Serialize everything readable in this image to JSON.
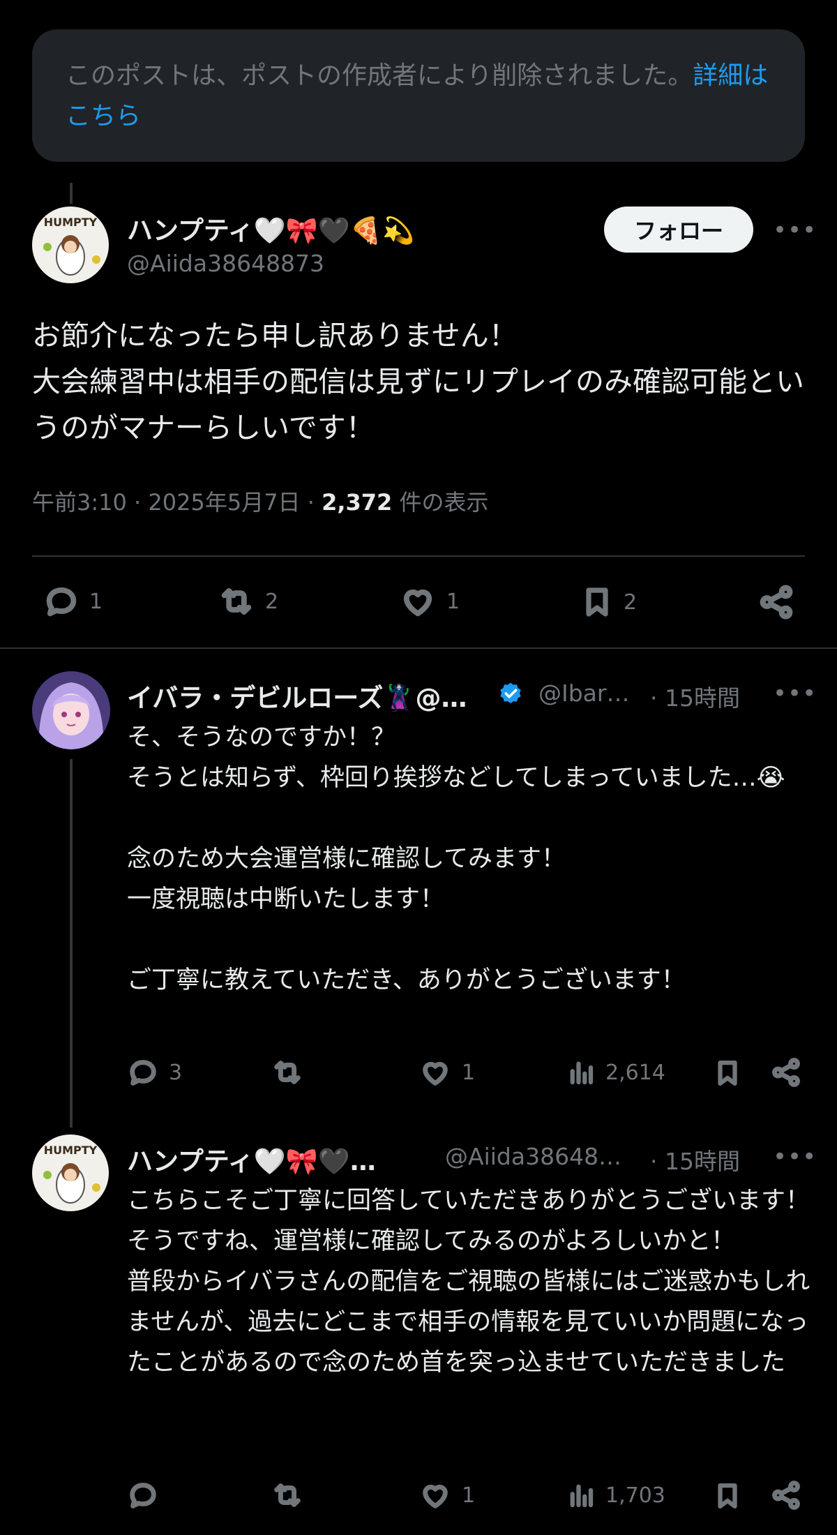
{
  "deleted_notice": {
    "text": "このポストは、ポストの作成者により削除されました。",
    "link": "詳細はこちら"
  },
  "main_post": {
    "display_name": "ハンプティ🤍🎀🖤🍕💫",
    "handle": "@Aiida38648873",
    "follow_label": "フォロー",
    "text": "お節介になったら申し訳ありません！\n大会練習中は相手の配信は見ずにリプレイのみ確認可能というのがマナーらしいです！",
    "time": "午前3:10",
    "date": "2025年5月7日",
    "views_count": "2,372",
    "views_label": "件の表示",
    "replies": "1",
    "reposts": "2",
    "likes": "1",
    "bookmarks": "2"
  },
  "reply1": {
    "display_name": "イバラ・デビルローズ🦹‍♂️@…",
    "handle": "@Ibar…",
    "time": "15時間",
    "text": "そ、そうなのですか！？\nそうとは知らず、枠回り挨拶などしてしまっていました…😭\n\n念のため大会運営様に確認してみます！\n一度視聴は中断いたします！\n\nご丁寧に教えていただき、ありがとうございます！",
    "replies": "3",
    "reposts": "",
    "likes": "1",
    "views": "2,614"
  },
  "reply2": {
    "display_name": "ハンプティ🤍🎀🖤…",
    "handle": "@Aiida38648…",
    "time": "15時間",
    "text": "こちらこそご丁寧に回答していただきありがとうございます！\nそうですね、運営様に確認してみるのがよろしいかと！\n普段からイバラさんの配信をご視聴の皆様にはご迷惑かもしれませんが、過去にどこまで相手の情報を見ていいか問題になったことがあるので念のため首を突っ込ませていただきました",
    "replies": "",
    "reposts": "",
    "likes": "1",
    "views": "1,703"
  },
  "avatar_text": "HUMPTY",
  "icons": [
    "more-icon",
    "reply-icon",
    "repost-icon",
    "like-icon",
    "bookmark-icon",
    "share-icon",
    "views-icon",
    "verified-icon"
  ],
  "colors": {
    "background": "#000000",
    "text": "#e7e9ea",
    "muted": "#71767b",
    "link": "#1d9bf0",
    "verified": "#1d9bf0",
    "divider": "#2f3336"
  }
}
